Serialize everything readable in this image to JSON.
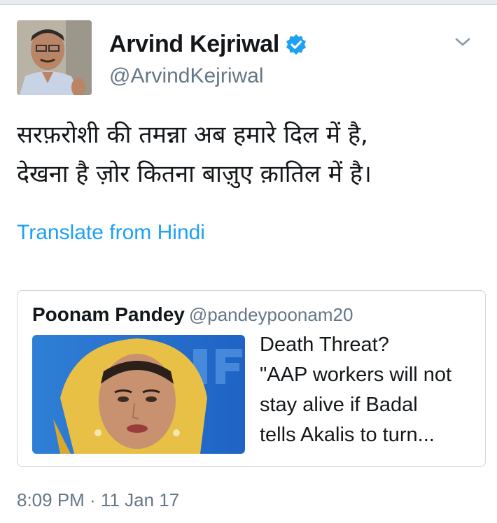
{
  "author": {
    "name": "Arvind Kejriwal",
    "handle": "@ArvindKejriwal",
    "verified_icon": "verified-badge-icon"
  },
  "tweet": {
    "lines": [
      "सरफ़रोशी की तमन्ना अब हमारे दिल में है,",
      "देखना है ज़ोर कितना बाज़ुए क़ातिल में है।"
    ],
    "translate_label": "Translate from Hindi"
  },
  "quoted": {
    "name": "Poonam Pandey",
    "handle": "@pandeypoonam20",
    "text_lines": [
      "Death Threat?",
      "\"AAP workers will not",
      "stay alive if Badal",
      "tells Akalis to turn..."
    ]
  },
  "timestamp": "8:09 PM · 11 Jan 17",
  "colors": {
    "link": "#1da1f2",
    "secondary": "#657786",
    "border": "#ccd6dd",
    "verified": "#1da1f2"
  }
}
